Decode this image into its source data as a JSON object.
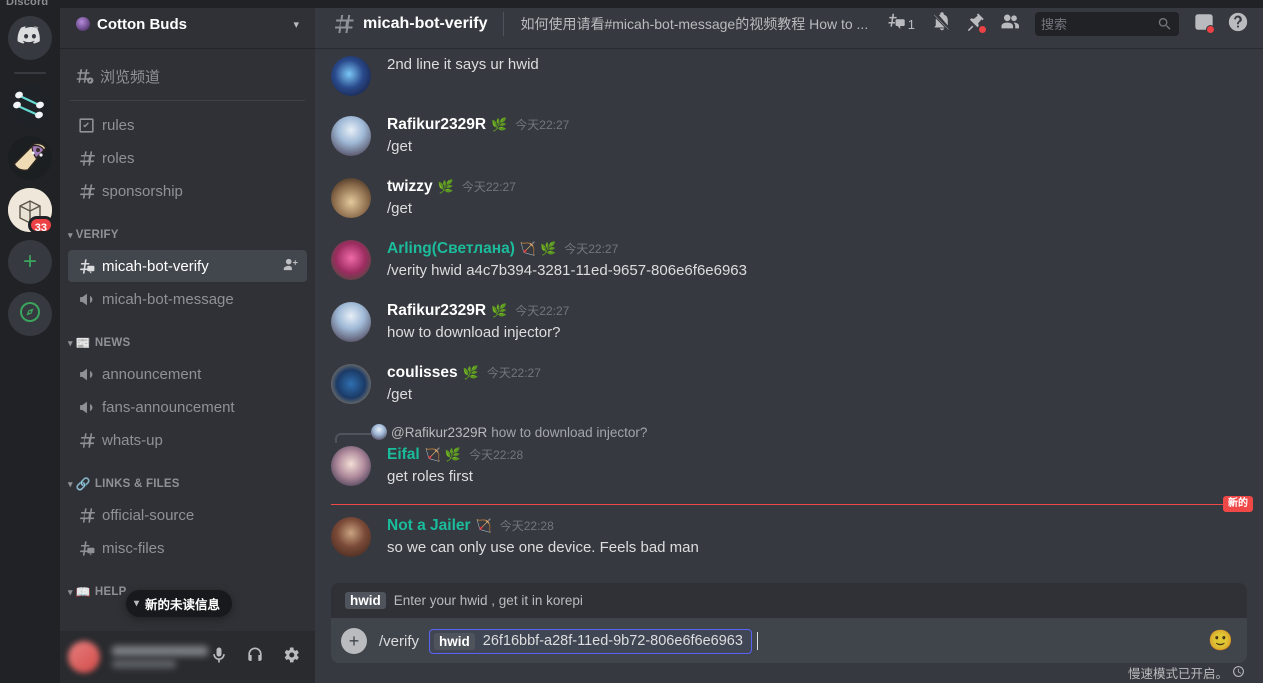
{
  "window": {
    "app_title": "Discord"
  },
  "server_rail": {
    "items": [
      {
        "name": "home",
        "icon": "discord-home-icon",
        "label": "Discord"
      },
      {
        "name": "cotton-buds",
        "icon": "cotton-buds-server-icon",
        "label": "Cotton Buds"
      },
      {
        "name": "burrito",
        "icon": "burrito-server-icon",
        "label": ""
      },
      {
        "name": "box",
        "icon": "box-server-icon",
        "label": "",
        "badge": "33"
      },
      {
        "name": "add-server",
        "icon": "plus-icon",
        "label": "+"
      },
      {
        "name": "explore",
        "icon": "compass-icon",
        "label": ""
      }
    ]
  },
  "sidebar": {
    "server_name": "Cotton Buds",
    "browse_channels": "浏览频道",
    "channels": [
      {
        "name": "rules",
        "icon": "rules-icon",
        "type": "rules"
      },
      {
        "name": "roles",
        "icon": "hash-icon",
        "type": "text"
      },
      {
        "name": "sponsorship",
        "icon": "hash-icon",
        "type": "text"
      }
    ],
    "categories": [
      {
        "label": "VERIFY",
        "emoji": "",
        "channels": [
          {
            "name": "micah-bot-verify",
            "icon": "hash-thread-icon",
            "type": "text",
            "active": true,
            "trailing_icon": "add-member-icon"
          },
          {
            "name": "micah-bot-message",
            "icon": "announcement-icon",
            "type": "announcement"
          }
        ]
      },
      {
        "label": "NEWS",
        "emoji": "📰",
        "channels": [
          {
            "name": "announcement",
            "icon": "announcement-icon",
            "type": "announcement"
          },
          {
            "name": "fans-announcement",
            "icon": "announcement-icon",
            "type": "announcement"
          },
          {
            "name": "whats-up",
            "icon": "hash-icon",
            "type": "text"
          }
        ]
      },
      {
        "label": "LINKS & FILES",
        "emoji": "🔗",
        "channels": [
          {
            "name": "official-source",
            "icon": "hash-icon",
            "type": "text"
          },
          {
            "name": "misc-files",
            "icon": "hash-thread-icon",
            "type": "text"
          }
        ]
      },
      {
        "label": "HELP",
        "emoji": "📖",
        "channels": []
      }
    ],
    "unread_pill": "新的未读信息"
  },
  "header": {
    "channel_name": "micah-bot-verify",
    "topic": "如何使用请看#micah-bot-message的视频教程 How to ...",
    "thread_count": "1",
    "icons": [
      "threads-icon",
      "notification-muted-icon",
      "pinned-messages-icon",
      "member-list-icon",
      "inbox-icon",
      "help-icon"
    ]
  },
  "search": {
    "placeholder": "搜索",
    "value": ""
  },
  "messages": [
    {
      "id": "m0",
      "compact": true,
      "avatar_class": "av-a",
      "author": "",
      "timestamp": "",
      "text": "2nd line it says ur hwid",
      "name_color": "white",
      "badges": []
    },
    {
      "id": "m1",
      "avatar_class": "av-b",
      "author": "Rafikur2329R",
      "timestamp": "今天22:27",
      "text": "/get",
      "name_color": "white",
      "badges": [
        "🌿"
      ]
    },
    {
      "id": "m2",
      "avatar_class": "av-c",
      "author": "twizzy",
      "timestamp": "今天22:27",
      "text": "/get",
      "name_color": "white",
      "badges": [
        "🌿"
      ]
    },
    {
      "id": "m3",
      "avatar_class": "av-d",
      "author": "Arling(Светлана)",
      "timestamp": "今天22:27",
      "text": "/verity hwid a4c7b394-3281-11ed-9657-806e6f6e6963",
      "name_color": "teal",
      "badges": [
        "🏹",
        "🌿"
      ]
    },
    {
      "id": "m4",
      "avatar_class": "av-b",
      "author": "Rafikur2329R",
      "timestamp": "今天22:27",
      "text": "how to download injector?",
      "name_color": "white",
      "badges": [
        "🌿"
      ]
    },
    {
      "id": "m5",
      "avatar_class": "av-e",
      "author": "coulisses",
      "timestamp": "今天22:27",
      "text": "/get",
      "name_color": "white",
      "badges": [
        "🌿"
      ]
    },
    {
      "id": "m6",
      "avatar_class": "av-f",
      "author": "Eifal",
      "timestamp": "今天22:28",
      "text": "get roles first",
      "name_color": "teal",
      "badges": [
        "🏹",
        "🌿"
      ],
      "reply": {
        "author": "@Rafikur2329R",
        "text": "how to download injector?",
        "avatar_class": "av-b"
      }
    },
    {
      "id": "m7",
      "avatar_class": "av-g",
      "author": "Not a Jailer",
      "timestamp": "今天22:28",
      "text": "so we can only use one device. Feels bad man",
      "name_color": "teal",
      "badges": [
        "🏹"
      ],
      "new_divider_above": true
    }
  ],
  "new_divider": {
    "label": "新的"
  },
  "composer": {
    "hint_key": "hwid",
    "hint_desc": "Enter your hwid , get it in korepi",
    "command": "/verify",
    "arg_key": "hwid",
    "arg_value": "26f16bbf-a28f-11ed-9b72-806e6f6e6963",
    "emoji_icon": "emoji-icon",
    "slowmode_text": "慢速模式已开启。"
  },
  "colors": {
    "accent": "#5865f2",
    "danger": "#ed4245",
    "new_divider": "#f04747",
    "teal_name": "#1abc9c",
    "sidebar_bg": "#2f3136",
    "main_bg": "#36393f",
    "rail_bg": "#202225"
  }
}
